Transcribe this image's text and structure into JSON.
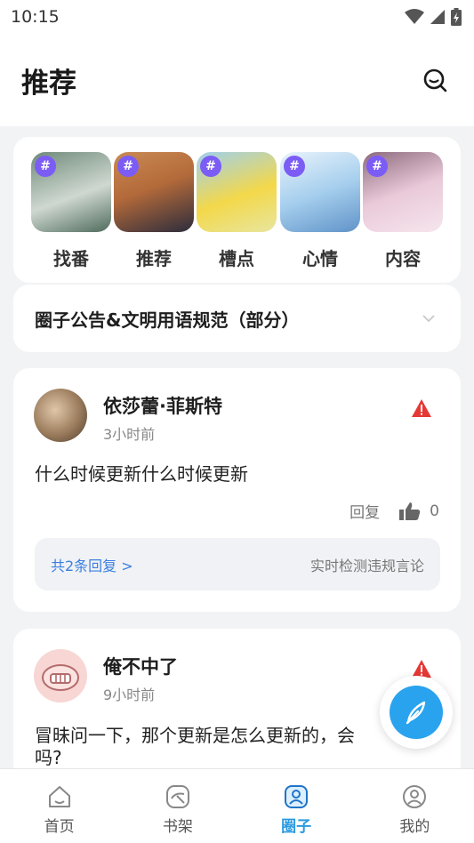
{
  "status": {
    "time": "10:15"
  },
  "header": {
    "title": "推荐",
    "search_icon": "search-icon"
  },
  "topics": [
    {
      "label": "找番",
      "badge": "#",
      "colors": [
        "#6f8a7a",
        "#cfd8d0"
      ]
    },
    {
      "label": "推荐",
      "badge": "#",
      "colors": [
        "#b46a3a",
        "#2c2c3c"
      ]
    },
    {
      "label": "槽点",
      "badge": "#",
      "colors": [
        "#f3d84a",
        "#9fd0ee"
      ]
    },
    {
      "label": "心情",
      "badge": "#",
      "colors": [
        "#a7cfee",
        "#e8f3fb"
      ]
    },
    {
      "label": "内容",
      "badge": "#",
      "colors": [
        "#e9c9d8",
        "#8c6a7e"
      ]
    }
  ],
  "notice": {
    "text": "圈子公告&文明用语规范（部分）"
  },
  "posts": [
    {
      "user": "依莎蕾·菲斯特",
      "time": "3小时前",
      "content": "什么时候更新什么时候更新",
      "reply_label": "回复",
      "likes": "0",
      "replies_text": "共2条回复 >",
      "moderation_text": "实时检测违规言论"
    },
    {
      "user": "俺不中了",
      "time": "9小时前",
      "content_line1": "冒昧问一下，那个更新是怎么更新的，会",
      "content_line2": "吗?"
    }
  ],
  "tabs": [
    {
      "label": "首页",
      "icon": "home-icon"
    },
    {
      "label": "书架",
      "icon": "bookshelf-icon"
    },
    {
      "label": "圈子",
      "icon": "circle-icon",
      "active": true
    },
    {
      "label": "我的",
      "icon": "profile-icon"
    }
  ],
  "colors": {
    "accent": "#2a9ae0",
    "fab": "#2aa3ef",
    "badge": "#7b5cf5",
    "warning": "#e53935"
  }
}
